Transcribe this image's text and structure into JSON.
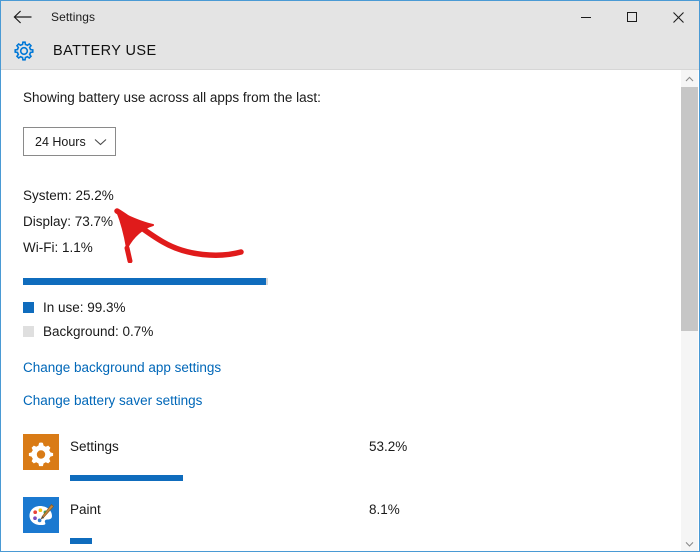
{
  "window": {
    "titlebar": {
      "back_label": "back-arrow",
      "title": "Settings",
      "minimize": "minimize",
      "maximize": "maximize",
      "close": "close"
    },
    "header": {
      "icon": "gear-icon",
      "title": "BATTERY USE",
      "accent_color": "#0078d7"
    }
  },
  "main": {
    "intro": "Showing battery use across all apps from the last:",
    "range_dropdown": {
      "value": "24 Hours",
      "chevron": "chevron-down-icon"
    },
    "stats": [
      "System: 25.2%",
      "Display: 73.7%",
      "Wi-Fi: 1.1%"
    ],
    "overall_bar": {
      "fill_percent": 99.3,
      "fill_color": "#0f6cbd",
      "track_color": "#d6d6d6"
    },
    "legend": [
      {
        "label": "In use: 99.3%",
        "color": "#0f6cbd"
      },
      {
        "label": "Background: 0.7%",
        "color": "#dfdfdf"
      }
    ],
    "links": [
      "Change background app settings",
      "Change battery saver settings"
    ],
    "apps": [
      {
        "name": "Settings",
        "percent_label": "53.2%",
        "bar_percent": 46,
        "icon": "settings-gear-app-icon",
        "icon_bg": "#d97b16"
      },
      {
        "name": "Paint",
        "percent_label": "8.1%",
        "bar_percent": 9,
        "icon": "paint-palette-app-icon",
        "icon_bg": "#1b79d0"
      }
    ]
  },
  "annotation": {
    "arrow": "red-curved-arrow-pointing-to-dropdown",
    "color": "#e01b1b"
  },
  "scrollbar": {
    "up_arrow": "scroll-up-icon",
    "down_arrow": "scroll-down-icon",
    "thumb": "scrollbar-thumb"
  }
}
